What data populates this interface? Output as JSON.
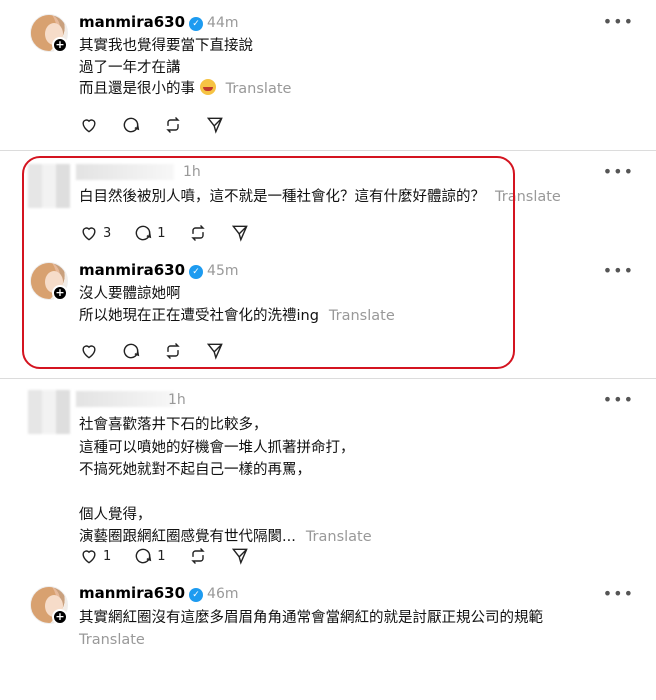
{
  "posts": [
    {
      "username": "manmira630",
      "time": "44m",
      "lines": [
        "其實我也覺得要當下直接說",
        "過了一年才在講",
        "而且還是很小的事"
      ],
      "translate": "Translate",
      "likes": "",
      "replies": ""
    },
    {
      "username": "",
      "time": "1h",
      "lines": [
        "白目然後被別人噴，這不就是一種社會化？這有什麼好體諒的？"
      ],
      "translate": "Translate",
      "likes": "3",
      "replies": "1"
    },
    {
      "username": "manmira630",
      "time": "45m",
      "lines": [
        "沒人要體諒她啊",
        "所以她現在正在遭受社會化的洗禮ing"
      ],
      "translate": "Translate",
      "likes": "",
      "replies": ""
    },
    {
      "username": "",
      "time": "1h",
      "lines": [
        "社會喜歡落井下石的比較多，",
        "這種可以噴她的好機會一堆人抓著拼命打，",
        "不搞死她就對不起自己一樣的再罵，",
        "",
        "個人覺得，",
        "演藝圈跟網紅圈感覺有世代隔閡..."
      ],
      "translate": "Translate",
      "likes": "1",
      "replies": "1"
    },
    {
      "username": "manmira630",
      "time": "46m",
      "lines": [
        "其實網紅圈沒有這麼多眉眉角角通常會當網紅的就是討厭正規公司的規範"
      ],
      "translate": "Translate"
    }
  ],
  "icons": {
    "more": "more-horizontal-icon",
    "like": "heart-icon",
    "reply": "comment-icon",
    "repost": "repost-icon",
    "share": "send-icon",
    "verified": "verified-badge-icon"
  },
  "colors": {
    "highlight": "#d41420",
    "verified": "#1d9bf0",
    "muted": "#999999"
  }
}
